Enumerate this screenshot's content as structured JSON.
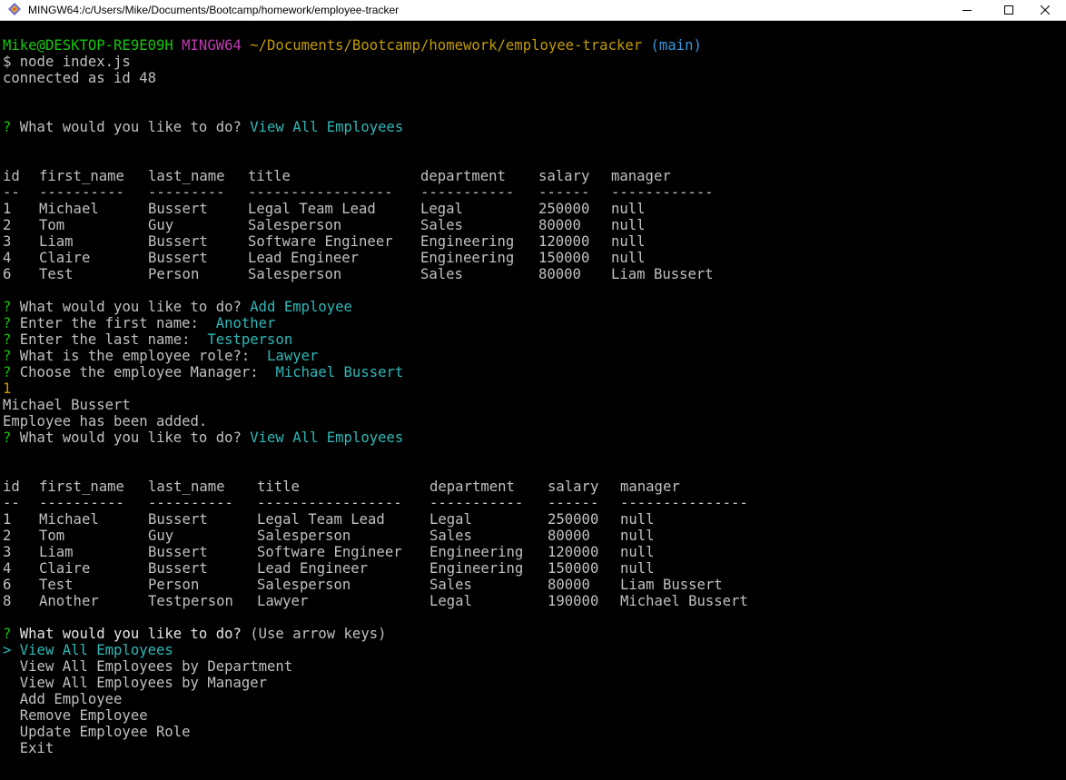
{
  "window": {
    "title": "MINGW64:/c/Users/Mike/Documents/Bootcamp/homework/employee-tracker"
  },
  "prompt": {
    "user_host": "Mike@DESKTOP-RE9E09H",
    "shell": "MINGW64",
    "path": "~/Documents/Bootcamp/homework/employee-tracker",
    "branch": "(main)",
    "command": "$ node index.js",
    "connected": "connected as id 48"
  },
  "q1": {
    "mark": "?",
    "text": " What would you like to do? ",
    "answer": "View All Employees"
  },
  "table1": {
    "headers": [
      "id",
      "first_name",
      "last_name",
      "title",
      "department",
      "salary",
      "manager"
    ],
    "dashes": [
      "--",
      "----------",
      "---------",
      "-----------------",
      "-----------",
      "------",
      "------------"
    ],
    "rows": [
      [
        "1",
        "Michael",
        "Bussert",
        "Legal Team Lead",
        "Legal",
        "250000",
        "null"
      ],
      [
        "2",
        "Tom",
        "Guy",
        "Salesperson",
        "Sales",
        "80000",
        "null"
      ],
      [
        "3",
        "Liam",
        "Bussert",
        "Software Engineer",
        "Engineering",
        "120000",
        "null"
      ],
      [
        "4",
        "Claire",
        "Bussert",
        "Lead Engineer",
        "Engineering",
        "150000",
        "null"
      ],
      [
        "6",
        "Test",
        "Person",
        "Salesperson",
        "Sales",
        "80000",
        "Liam Bussert"
      ]
    ]
  },
  "add_prompts": [
    {
      "mark": "?",
      "text": " What would you like to do? ",
      "answer": "Add Employee"
    },
    {
      "mark": "?",
      "text": " Enter the first name:  ",
      "answer": "Another"
    },
    {
      "mark": "?",
      "text": " Enter the last name:  ",
      "answer": "Testperson"
    },
    {
      "mark": "?",
      "text": " What is the employee role?:  ",
      "answer": "Lawyer"
    },
    {
      "mark": "?",
      "text": " Choose the employee Manager:  ",
      "answer": "Michael Bussert"
    }
  ],
  "output": {
    "manager_id": "1",
    "manager_name": "Michael Bussert",
    "added_message": "Employee has been added."
  },
  "q2": {
    "mark": "?",
    "text": " What would you like to do? ",
    "answer": "View All Employees"
  },
  "table2": {
    "headers": [
      "id",
      "first_name",
      "last_name",
      "title",
      "department",
      "salary",
      "manager"
    ],
    "dashes": [
      "--",
      "----------",
      "----------",
      "-----------------",
      "-----------",
      "------",
      "---------------"
    ],
    "rows": [
      [
        "1",
        "Michael",
        "Bussert",
        "Legal Team Lead",
        "Legal",
        "250000",
        "null"
      ],
      [
        "2",
        "Tom",
        "Guy",
        "Salesperson",
        "Sales",
        "80000",
        "null"
      ],
      [
        "3",
        "Liam",
        "Bussert",
        "Software Engineer",
        "Engineering",
        "120000",
        "null"
      ],
      [
        "4",
        "Claire",
        "Bussert",
        "Lead Engineer",
        "Engineering",
        "150000",
        "null"
      ],
      [
        "6",
        "Test",
        "Person",
        "Salesperson",
        "Sales",
        "80000",
        "Liam Bussert"
      ],
      [
        "8",
        "Another",
        "Testperson",
        "Lawyer",
        "Legal",
        "190000",
        "Michael Bussert"
      ]
    ]
  },
  "menu": {
    "mark": "?",
    "question": " What would you like to do? ",
    "hint": "(Use arrow keys)",
    "pointer": ">",
    "selected": "View All Employees",
    "items": [
      "View All Employees by Department",
      "View All Employees by Manager",
      "Add Employee",
      "Remove Employee",
      "Update Employee Role",
      "Exit"
    ]
  },
  "colors": {
    "background": "#000000",
    "text": "#c0c0c0",
    "prompt_user": "#16c60c",
    "prompt_shell": "#c239b3",
    "prompt_path": "#c19c00",
    "answer": "#2fb7b7"
  }
}
